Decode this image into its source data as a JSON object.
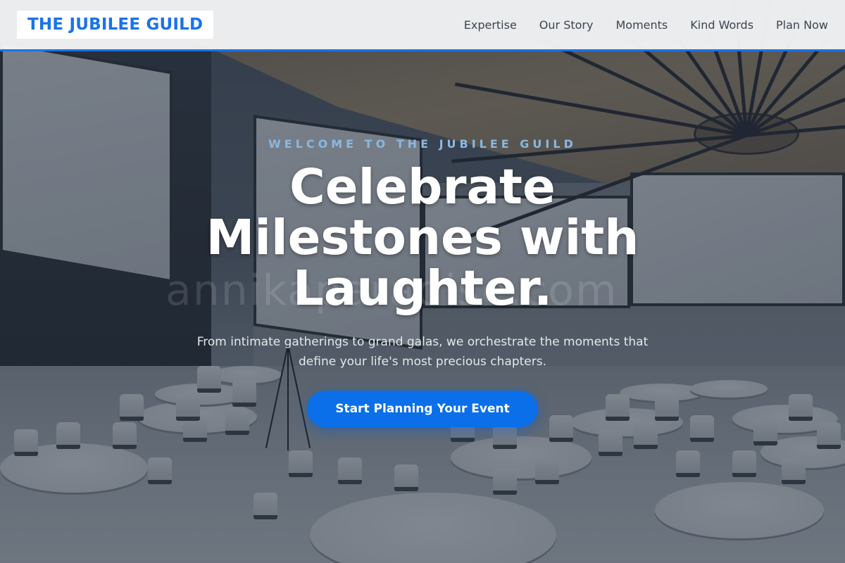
{
  "header": {
    "logo": "THE JUBILEE GUILD",
    "nav": [
      {
        "label": "Expertise"
      },
      {
        "label": "Our Story"
      },
      {
        "label": "Moments"
      },
      {
        "label": "Kind Words"
      },
      {
        "label": "Plan Now"
      }
    ]
  },
  "hero": {
    "eyebrow": "WELCOME TO THE JUBILEE GUILD",
    "headline": "Celebrate Milestones with Laughter.",
    "subtext": "From intimate gatherings to grand galas, we orchestrate the moments that define your life's most precious chapters.",
    "cta_label": "Start Planning Your Event",
    "watermark": "annikaparadise.com",
    "background_image": "conference-hall-with-round-tables-and-projection-screens"
  },
  "colors": {
    "accent": "#1a73e8",
    "cta": "#0a6fe8",
    "eyebrow": "#8ab8e0",
    "nav_text": "#3c4550"
  }
}
